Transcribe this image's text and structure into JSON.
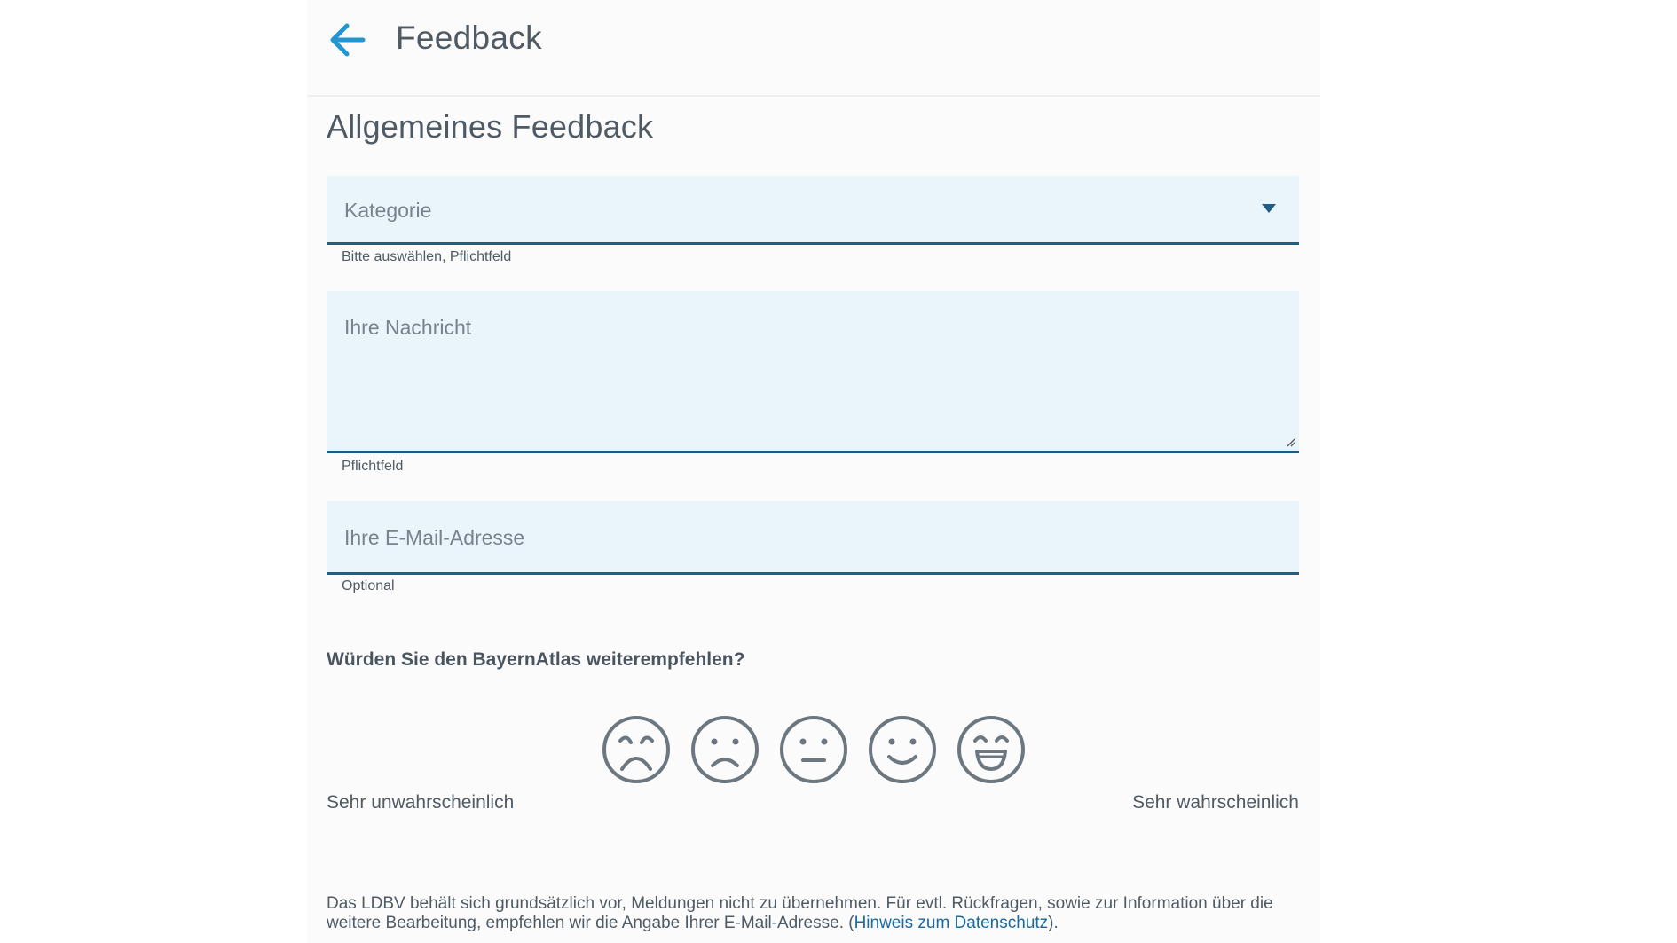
{
  "header": {
    "title": "Feedback",
    "back_icon": "arrow-left-icon",
    "accent_color": "#2196d3"
  },
  "form": {
    "section_title": "Allgemeines Feedback",
    "category": {
      "placeholder": "Kategorie",
      "hint": "Bitte auswählen,  Pflichtfeld"
    },
    "message": {
      "placeholder": "Ihre Nachricht",
      "hint": "Pflichtfeld"
    },
    "email": {
      "placeholder": "Ihre E-Mail-Adresse",
      "hint": "Optional"
    },
    "field_background": "#eaf4fb",
    "field_border_color": "#1f5f86"
  },
  "recommendation": {
    "question": "Würden Sie den BayernAtlas weiterempfehlen?",
    "faces": [
      "very-unhappy-face-icon",
      "sad-face-icon",
      "neutral-face-icon",
      "smile-face-icon",
      "laughing-face-icon"
    ],
    "low_label": "Sehr unwahrscheinlich",
    "high_label": "Sehr wahrscheinlich"
  },
  "footer": {
    "text": "Das LDBV behält sich grundsätzlich vor, Meldungen nicht zu übernehmen. Für evtl. Rückfragen, sowie zur Information über die weitere Bearbeitung, empfehlen wir die Angabe Ihrer E-Mail-Adresse. (",
    "link": "Hinweis zum Datenschutz",
    "text_end": ")."
  }
}
